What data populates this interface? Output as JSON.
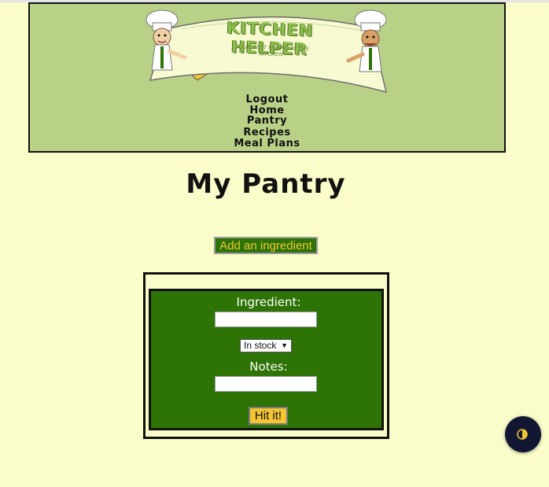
{
  "header": {
    "logo_title": "KITCHEN HELPER",
    "logo_tagline": "YOUR BEST FRIEND IN THE KITCHEN!",
    "nav": [
      "Logout",
      "Home",
      "Pantry",
      "Recipes",
      "Meal Plans"
    ]
  },
  "page": {
    "title": "My Pantry",
    "add_button": "Add an ingredient"
  },
  "form": {
    "ingredient_label": "Ingredient:",
    "ingredient_value": "",
    "status_selected": "In stock",
    "notes_label": "Notes:",
    "notes_value": "",
    "submit_label": "Hit it!"
  },
  "colors": {
    "page_bg": "#fafdc9",
    "header_bg": "#b9d187",
    "form_bg": "#2d7305",
    "accent_yellow": "#f3c535"
  },
  "icons": {
    "fab": "contrast-toggle-icon"
  }
}
